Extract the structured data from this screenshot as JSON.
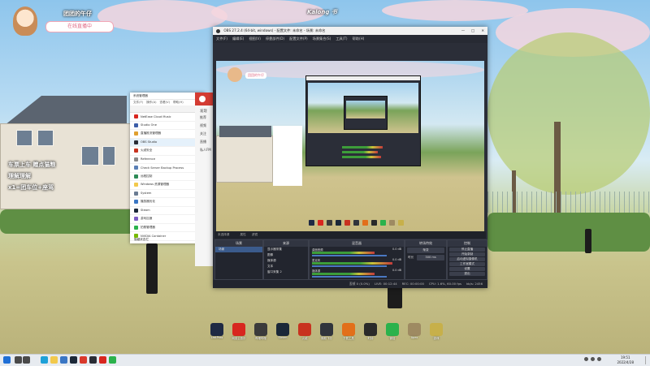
{
  "desktop": {
    "streamer_tag": "团团的午仔",
    "streamer_sub": "在线直播中",
    "watermark": "Kalong 书",
    "overlay_line1": "车票上车  赠点猫粮",
    "overlay_line2": "理解理解",
    "overlay_line3": "x1=团车位+座驾"
  },
  "mini_window": {
    "title": "系统管理器",
    "menu": [
      "文件(F)",
      "操作(A)",
      "查看(V)",
      "帮助(H)"
    ],
    "items": [
      "NetEase Cloud Music",
      "Studio One",
      "直播推流管理器",
      "OBS Studio",
      "火绒安全",
      "Reference",
      "Check Server Backup Process",
      "远程控制",
      "Windows 资源管理器",
      "System",
      "播放器优化",
      "Steam",
      "游戏加速",
      "拍照管理器",
      "NVIDIA Container"
    ],
    "footer": "隐藏状态栏"
  },
  "red_panel": {
    "heading": "发现",
    "items": [
      "推荐",
      "视频",
      "关注",
      "直播",
      "私人FM"
    ]
  },
  "obs": {
    "title": "OBS 27.2.4 (64-bit, windows) - 配置文件: 未命名 - 场景: 未命名",
    "menu": [
      "文件(F)",
      "编辑(E)",
      "视图(V)",
      "停靠部件(D)",
      "配置文件(P)",
      "场景集合(S)",
      "工具(T)",
      "帮助(H)"
    ],
    "preview_tag": "团团的午仔",
    "scene_label": "场景",
    "sources_label": "来源",
    "mixer_label": "混音器",
    "transitions_label": "转场特效",
    "controls_label": "控制",
    "scene_list": [
      "场景"
    ],
    "source_list": [
      "显示器采集",
      "图像",
      "媒体源",
      "文本",
      "窗口采集 2"
    ],
    "mixer_tracks": [
      {
        "name": "桌面音频",
        "db": "0.0 dB"
      },
      {
        "name": "麦克风",
        "db": "0.0 dB"
      },
      {
        "name": "媒体源",
        "db": "0.0 dB"
      }
    ],
    "transition_type": "渐变",
    "transition_duration_label": "时长",
    "transition_duration": "300 ms",
    "controls": [
      "停止直播",
      "开始录制",
      "启动虚拟摄像机",
      "工作室模式",
      "设置",
      "退出"
    ],
    "no_source_selected": "未选择源",
    "properties_label": "属性",
    "filters_label": "滤镜",
    "status": {
      "dropped": "丢帧 0 (0.0%)",
      "live": "LIVE: 00:12:44",
      "rec": "REC: 00:00:00",
      "cpu": "CPU: 1.6%, 60.00 fps",
      "kbps": "kb/s: 2456"
    }
  },
  "desktop_icons": [
    {
      "label": "LastPass",
      "color": "#1f2a44"
    },
    {
      "label": "网易云音乐",
      "color": "#d8261f"
    },
    {
      "label": "哔哩哔哩",
      "color": "#3b3b3b"
    },
    {
      "label": "Steam",
      "color": "#1b2838"
    },
    {
      "label": "火绒",
      "color": "#c8331f"
    },
    {
      "label": "微软飞行",
      "color": "#30343c"
    },
    {
      "label": "下载工具",
      "color": "#e26f1a"
    },
    {
      "label": "时钟",
      "color": "#2a2a2a"
    },
    {
      "label": "微信",
      "color": "#2bb24c"
    },
    {
      "label": "Apex",
      "color": "#9e8a62"
    },
    {
      "label": "游戏",
      "color": "#c7b04a"
    }
  ],
  "taskbar": {
    "icons": [
      {
        "name": "start",
        "color": "#1f6fd6"
      },
      {
        "name": "search",
        "color": "#4a4a4a"
      },
      {
        "name": "task-view",
        "color": "#4a4a4a"
      },
      {
        "name": "edge",
        "color": "#1ea1d8"
      },
      {
        "name": "explorer",
        "color": "#f2c94c"
      },
      {
        "name": "store",
        "color": "#3a76c4"
      },
      {
        "name": "steam",
        "color": "#1b2838"
      },
      {
        "name": "chrome",
        "color": "#d9392c"
      },
      {
        "name": "obs",
        "color": "#2a2d36"
      },
      {
        "name": "netease",
        "color": "#d8261f"
      },
      {
        "name": "wechat",
        "color": "#2bb24c"
      }
    ],
    "time": "19:51",
    "date": "2022/4/28"
  }
}
